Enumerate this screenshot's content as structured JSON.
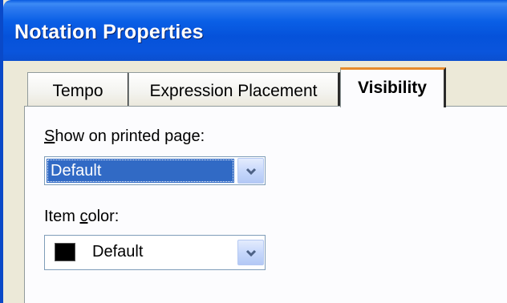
{
  "window": {
    "title": "Notation Properties"
  },
  "tabs": [
    {
      "label": "Tempo",
      "active": false
    },
    {
      "label": "Expression Placement",
      "active": false
    },
    {
      "label": "Visibility",
      "active": true
    }
  ],
  "visibility_panel": {
    "show_on_printed_page": {
      "label_prefix": "",
      "label_underlined": "S",
      "label_rest": "how on printed page:",
      "selected_value": "Default"
    },
    "item_color": {
      "label_prefix": "Item ",
      "label_underlined": "c",
      "label_rest": "olor:",
      "selected_value": "Default",
      "swatch_color": "#000000"
    }
  },
  "icons": {
    "dropdown_arrow": "chevron-down-icon"
  },
  "colors": {
    "titlebar": "#0a5fe6",
    "selection": "#316ac5",
    "active_tab_accent": "#e68b2c",
    "dialog_background": "#ece9d8"
  }
}
